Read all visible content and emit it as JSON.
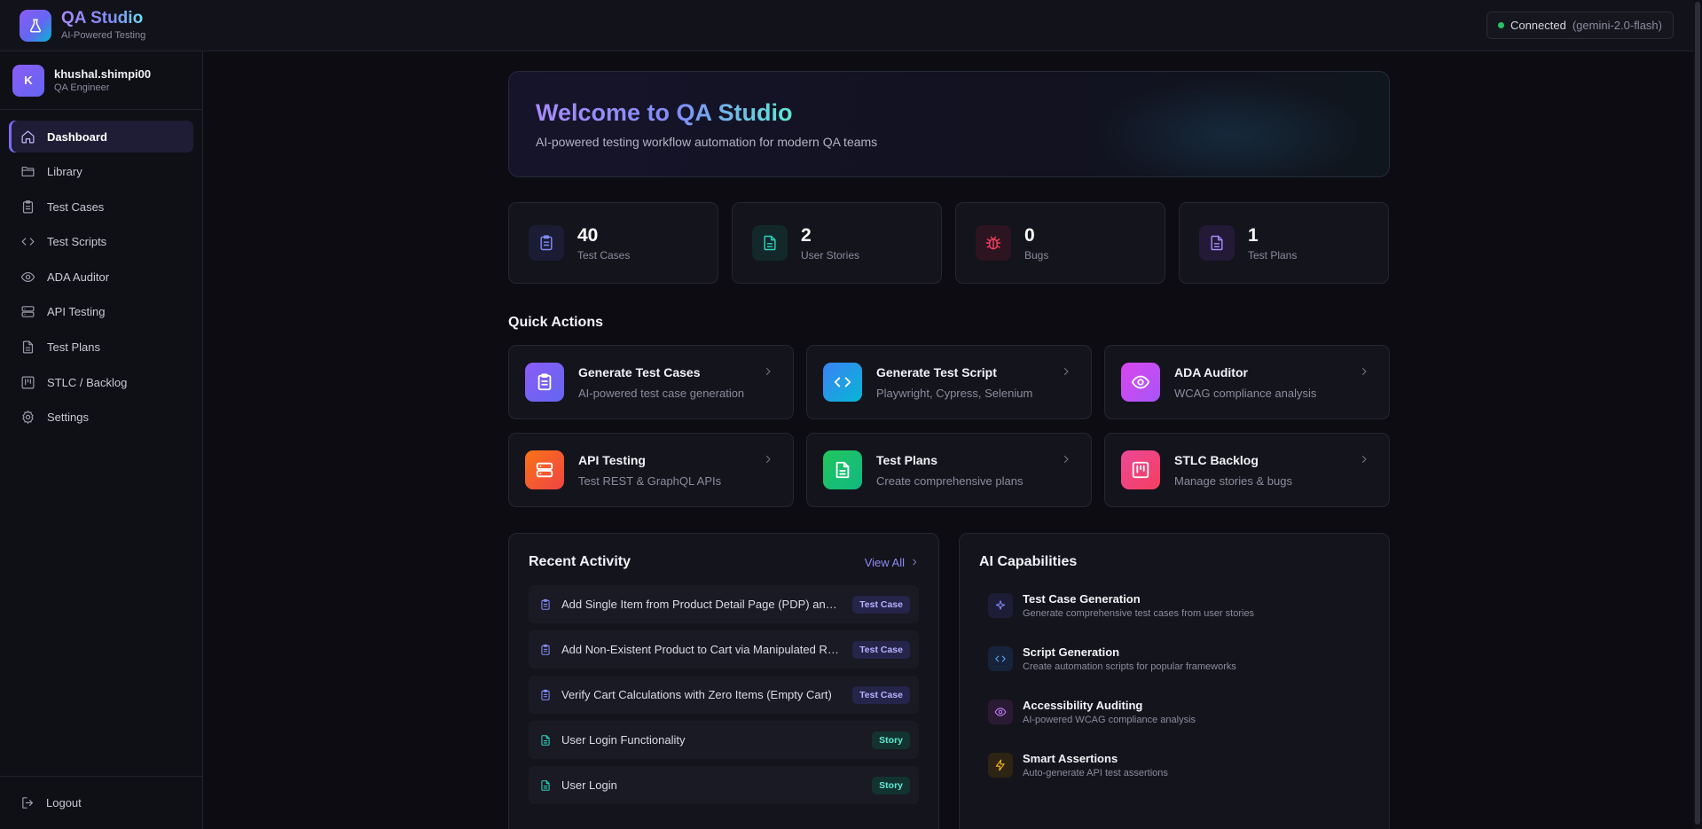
{
  "header": {
    "title": "QA Studio",
    "subtitle": "AI-Powered Testing",
    "status_label": "Connected",
    "status_model": "(gemini-2.0-flash)"
  },
  "user": {
    "initial": "K",
    "name": "khushal.shimpi00",
    "role": "QA Engineer"
  },
  "sidebar": {
    "items": [
      {
        "label": "Dashboard",
        "icon": "home-icon"
      },
      {
        "label": "Library",
        "icon": "folder-icon"
      },
      {
        "label": "Test Cases",
        "icon": "clipboard-icon"
      },
      {
        "label": "Test Scripts",
        "icon": "code-icon"
      },
      {
        "label": "ADA Auditor",
        "icon": "eye-icon"
      },
      {
        "label": "API Testing",
        "icon": "server-icon"
      },
      {
        "label": "Test Plans",
        "icon": "document-icon"
      },
      {
        "label": "STLC / Backlog",
        "icon": "kanban-icon"
      },
      {
        "label": "Settings",
        "icon": "gear-icon"
      }
    ],
    "logout_label": "Logout"
  },
  "welcome": {
    "title": "Welcome to QA Studio",
    "subtitle": "AI-powered testing workflow automation for modern QA teams"
  },
  "stats": [
    {
      "value": "40",
      "label": "Test Cases",
      "icon": "clipboard-icon",
      "color": "#818cf8"
    },
    {
      "value": "2",
      "label": "User Stories",
      "icon": "file-text-icon",
      "color": "#2dd4bf"
    },
    {
      "value": "0",
      "label": "Bugs",
      "icon": "bug-icon",
      "color": "#f43f5e"
    },
    {
      "value": "1",
      "label": "Test Plans",
      "icon": "document-icon",
      "color": "#a78bfa"
    }
  ],
  "quick_actions": {
    "title": "Quick Actions",
    "items": [
      {
        "title": "Generate Test Cases",
        "desc": "AI-powered test case generation",
        "icon": "clipboard-icon"
      },
      {
        "title": "Generate Test Script",
        "desc": "Playwright, Cypress, Selenium",
        "icon": "code-icon"
      },
      {
        "title": "ADA Auditor",
        "desc": "WCAG compliance analysis",
        "icon": "eye-icon"
      },
      {
        "title": "API Testing",
        "desc": "Test REST & GraphQL APIs",
        "icon": "server-icon"
      },
      {
        "title": "Test Plans",
        "desc": "Create comprehensive plans",
        "icon": "document-icon"
      },
      {
        "title": "STLC Backlog",
        "desc": "Manage stories & bugs",
        "icon": "kanban-icon"
      }
    ]
  },
  "recent_activity": {
    "title": "Recent Activity",
    "view_all": "View All",
    "items": [
      {
        "text": "Add Single Item from Product Detail Page (PDP) and Ve...",
        "badge": "Test Case"
      },
      {
        "text": "Add Non-Existent Product to Cart via Manipulated Requ...",
        "badge": "Test Case"
      },
      {
        "text": "Verify Cart Calculations with Zero Items (Empty Cart)",
        "badge": "Test Case"
      },
      {
        "text": "User Login Functionality",
        "badge": "Story"
      },
      {
        "text": "User Login",
        "badge": "Story"
      }
    ]
  },
  "ai_capabilities": {
    "title": "AI Capabilities",
    "items": [
      {
        "title": "Test Case Generation",
        "desc": "Generate comprehensive test cases from user stories",
        "icon": "sparkle-icon"
      },
      {
        "title": "Script Generation",
        "desc": "Create automation scripts for popular frameworks",
        "icon": "code-icon"
      },
      {
        "title": "Accessibility Auditing",
        "desc": "AI-powered WCAG compliance analysis",
        "icon": "eye-icon"
      },
      {
        "title": "Smart Assertions",
        "desc": "Auto-generate API test assertions",
        "icon": "lightning-icon"
      }
    ]
  }
}
